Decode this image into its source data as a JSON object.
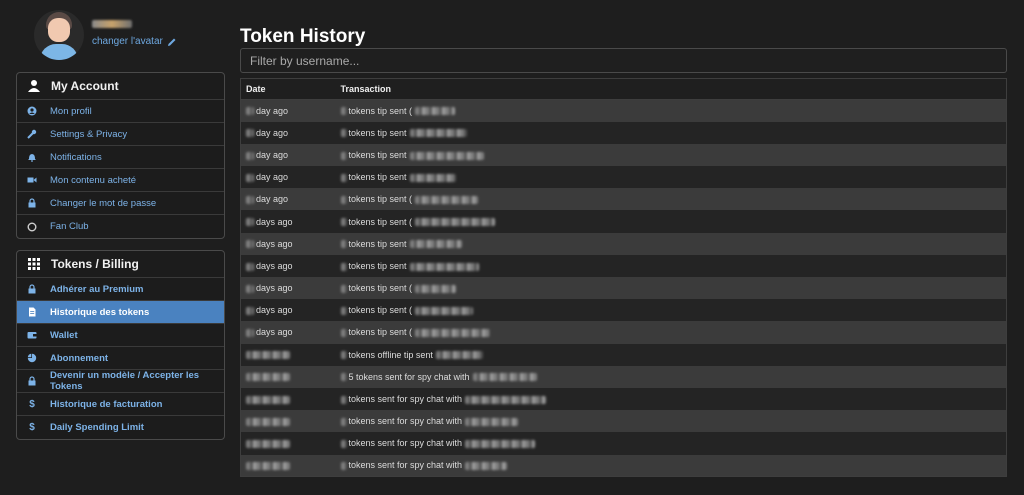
{
  "profile": {
    "change_avatar": "changer l'avatar"
  },
  "account_menu": {
    "title": "My Account",
    "items": [
      {
        "label": "Mon profil",
        "icon": "user-circle-icon"
      },
      {
        "label": "Settings & Privacy",
        "icon": "wrench-icon"
      },
      {
        "label": "Notifications",
        "icon": "bell-icon"
      },
      {
        "label": "Mon contenu acheté",
        "icon": "video-icon"
      },
      {
        "label": "Changer le mot de passe",
        "icon": "lock-icon"
      },
      {
        "label": "Fan Club",
        "icon": "circle-icon"
      }
    ]
  },
  "billing_menu": {
    "title": "Tokens / Billing",
    "items": [
      {
        "label": "Adhérer au Premium",
        "icon": "lock-icon"
      },
      {
        "label": "Historique des tokens",
        "icon": "document-icon",
        "active": true
      },
      {
        "label": "Wallet",
        "icon": "wallet-icon"
      },
      {
        "label": "Abonnement",
        "icon": "pie-chart-icon"
      },
      {
        "label": "Devenir un modèle / Accepter les Tokens",
        "icon": "lock-icon"
      },
      {
        "label": "Historique de facturation",
        "icon": "dollar-icon"
      },
      {
        "label": "Daily Spending Limit",
        "icon": "dollar-icon"
      }
    ]
  },
  "main": {
    "title": "Token History",
    "filter_placeholder": "Filter by username...",
    "columns": [
      "Date",
      "Transaction"
    ],
    "rows": [
      {
        "date": "day ago",
        "transaction": "tokens tip sent ("
      },
      {
        "date": "day ago",
        "transaction": "tokens tip sent"
      },
      {
        "date": "day ago",
        "transaction": "tokens tip sent"
      },
      {
        "date": "day ago",
        "transaction": "tokens tip sent"
      },
      {
        "date": "day ago",
        "transaction": "tokens tip sent ("
      },
      {
        "date": "days ago",
        "transaction": "tokens tip sent ("
      },
      {
        "date": "days ago",
        "transaction": "tokens tip sent"
      },
      {
        "date": "days ago",
        "transaction": "tokens tip sent"
      },
      {
        "date": "days ago",
        "transaction": "tokens tip sent ("
      },
      {
        "date": "days ago",
        "transaction": "tokens tip sent ("
      },
      {
        "date": "days ago",
        "transaction": "tokens tip sent ("
      },
      {
        "date": "",
        "transaction": "tokens offline tip sent"
      },
      {
        "date": "",
        "transaction": "5 tokens sent for spy chat with"
      },
      {
        "date": "",
        "transaction": "tokens sent for spy chat with"
      },
      {
        "date": "",
        "transaction": "tokens sent for spy chat with"
      },
      {
        "date": "",
        "transaction": "tokens sent for spy chat with"
      },
      {
        "date": "",
        "transaction": "tokens sent for spy chat with"
      }
    ]
  },
  "colors": {
    "background": "#1e1e1e",
    "link": "#7db3e8",
    "active": "#4a82c0",
    "row_odd": "#3b3b3b",
    "row_even": "#242424"
  }
}
